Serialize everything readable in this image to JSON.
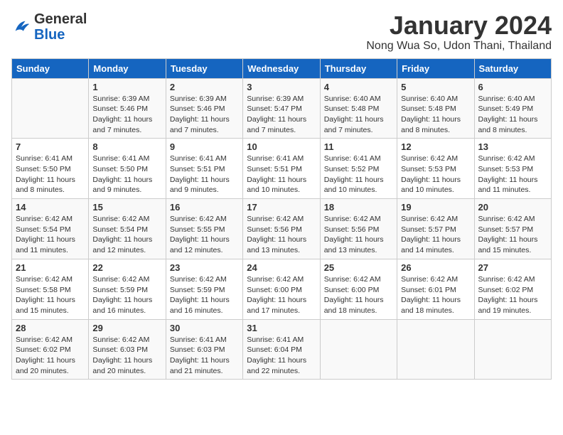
{
  "header": {
    "logo_general": "General",
    "logo_blue": "Blue",
    "month_title": "January 2024",
    "subtitle": "Nong Wua So, Udon Thani, Thailand"
  },
  "weekdays": [
    "Sunday",
    "Monday",
    "Tuesday",
    "Wednesday",
    "Thursday",
    "Friday",
    "Saturday"
  ],
  "weeks": [
    [
      {
        "day": "",
        "info": ""
      },
      {
        "day": "1",
        "info": "Sunrise: 6:39 AM\nSunset: 5:46 PM\nDaylight: 11 hours\nand 7 minutes."
      },
      {
        "day": "2",
        "info": "Sunrise: 6:39 AM\nSunset: 5:46 PM\nDaylight: 11 hours\nand 7 minutes."
      },
      {
        "day": "3",
        "info": "Sunrise: 6:39 AM\nSunset: 5:47 PM\nDaylight: 11 hours\nand 7 minutes."
      },
      {
        "day": "4",
        "info": "Sunrise: 6:40 AM\nSunset: 5:48 PM\nDaylight: 11 hours\nand 7 minutes."
      },
      {
        "day": "5",
        "info": "Sunrise: 6:40 AM\nSunset: 5:48 PM\nDaylight: 11 hours\nand 8 minutes."
      },
      {
        "day": "6",
        "info": "Sunrise: 6:40 AM\nSunset: 5:49 PM\nDaylight: 11 hours\nand 8 minutes."
      }
    ],
    [
      {
        "day": "7",
        "info": "Sunrise: 6:41 AM\nSunset: 5:50 PM\nDaylight: 11 hours\nand 8 minutes."
      },
      {
        "day": "8",
        "info": "Sunrise: 6:41 AM\nSunset: 5:50 PM\nDaylight: 11 hours\nand 9 minutes."
      },
      {
        "day": "9",
        "info": "Sunrise: 6:41 AM\nSunset: 5:51 PM\nDaylight: 11 hours\nand 9 minutes."
      },
      {
        "day": "10",
        "info": "Sunrise: 6:41 AM\nSunset: 5:51 PM\nDaylight: 11 hours\nand 10 minutes."
      },
      {
        "day": "11",
        "info": "Sunrise: 6:41 AM\nSunset: 5:52 PM\nDaylight: 11 hours\nand 10 minutes."
      },
      {
        "day": "12",
        "info": "Sunrise: 6:42 AM\nSunset: 5:53 PM\nDaylight: 11 hours\nand 10 minutes."
      },
      {
        "day": "13",
        "info": "Sunrise: 6:42 AM\nSunset: 5:53 PM\nDaylight: 11 hours\nand 11 minutes."
      }
    ],
    [
      {
        "day": "14",
        "info": "Sunrise: 6:42 AM\nSunset: 5:54 PM\nDaylight: 11 hours\nand 11 minutes."
      },
      {
        "day": "15",
        "info": "Sunrise: 6:42 AM\nSunset: 5:54 PM\nDaylight: 11 hours\nand 12 minutes."
      },
      {
        "day": "16",
        "info": "Sunrise: 6:42 AM\nSunset: 5:55 PM\nDaylight: 11 hours\nand 12 minutes."
      },
      {
        "day": "17",
        "info": "Sunrise: 6:42 AM\nSunset: 5:56 PM\nDaylight: 11 hours\nand 13 minutes."
      },
      {
        "day": "18",
        "info": "Sunrise: 6:42 AM\nSunset: 5:56 PM\nDaylight: 11 hours\nand 13 minutes."
      },
      {
        "day": "19",
        "info": "Sunrise: 6:42 AM\nSunset: 5:57 PM\nDaylight: 11 hours\nand 14 minutes."
      },
      {
        "day": "20",
        "info": "Sunrise: 6:42 AM\nSunset: 5:57 PM\nDaylight: 11 hours\nand 15 minutes."
      }
    ],
    [
      {
        "day": "21",
        "info": "Sunrise: 6:42 AM\nSunset: 5:58 PM\nDaylight: 11 hours\nand 15 minutes."
      },
      {
        "day": "22",
        "info": "Sunrise: 6:42 AM\nSunset: 5:59 PM\nDaylight: 11 hours\nand 16 minutes."
      },
      {
        "day": "23",
        "info": "Sunrise: 6:42 AM\nSunset: 5:59 PM\nDaylight: 11 hours\nand 16 minutes."
      },
      {
        "day": "24",
        "info": "Sunrise: 6:42 AM\nSunset: 6:00 PM\nDaylight: 11 hours\nand 17 minutes."
      },
      {
        "day": "25",
        "info": "Sunrise: 6:42 AM\nSunset: 6:00 PM\nDaylight: 11 hours\nand 18 minutes."
      },
      {
        "day": "26",
        "info": "Sunrise: 6:42 AM\nSunset: 6:01 PM\nDaylight: 11 hours\nand 18 minutes."
      },
      {
        "day": "27",
        "info": "Sunrise: 6:42 AM\nSunset: 6:02 PM\nDaylight: 11 hours\nand 19 minutes."
      }
    ],
    [
      {
        "day": "28",
        "info": "Sunrise: 6:42 AM\nSunset: 6:02 PM\nDaylight: 11 hours\nand 20 minutes."
      },
      {
        "day": "29",
        "info": "Sunrise: 6:42 AM\nSunset: 6:03 PM\nDaylight: 11 hours\nand 20 minutes."
      },
      {
        "day": "30",
        "info": "Sunrise: 6:41 AM\nSunset: 6:03 PM\nDaylight: 11 hours\nand 21 minutes."
      },
      {
        "day": "31",
        "info": "Sunrise: 6:41 AM\nSunset: 6:04 PM\nDaylight: 11 hours\nand 22 minutes."
      },
      {
        "day": "",
        "info": ""
      },
      {
        "day": "",
        "info": ""
      },
      {
        "day": "",
        "info": ""
      }
    ]
  ]
}
